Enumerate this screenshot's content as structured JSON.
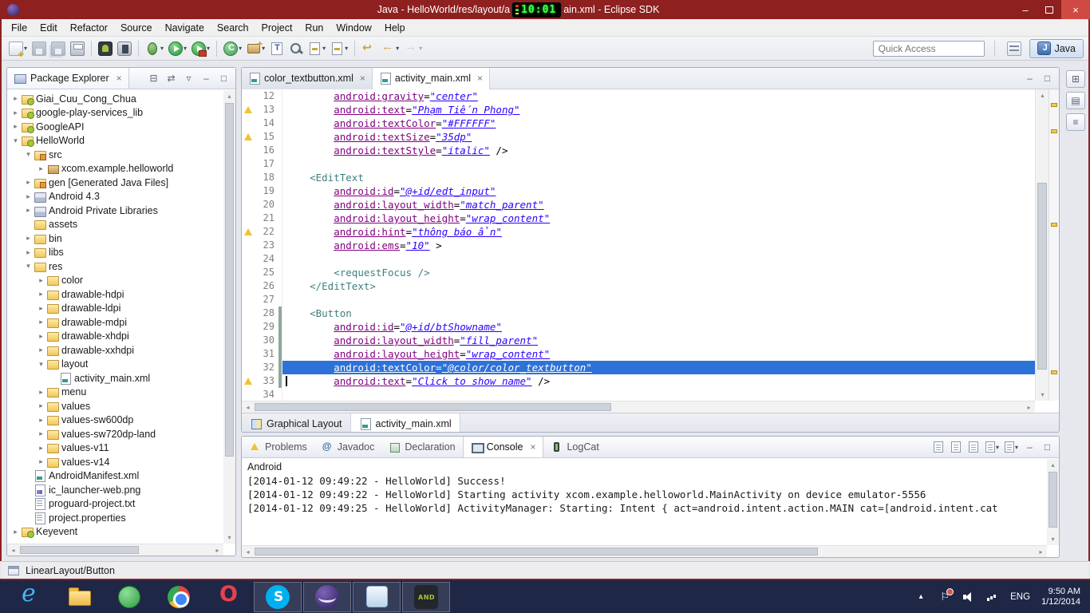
{
  "colors": {
    "titlebar": "#8e2020",
    "close_button": "#cf4a42",
    "selection": "#2d72d9",
    "taskbar": "#1f2747",
    "xml_attr": "#7f007f",
    "xml_value": "#2a00ff",
    "xml_tag": "#3f7f7f",
    "warning": "#f1c232",
    "clock_digits": "#42ff49"
  },
  "titlebar": {
    "title_left": "Java - HelloWorld/res/layout/a",
    "clock": "10:01",
    "title_right": "ain.xml - Eclipse SDK"
  },
  "menubar": [
    "File",
    "Edit",
    "Refactor",
    "Source",
    "Navigate",
    "Search",
    "Project",
    "Run",
    "Window",
    "Help"
  ],
  "toolbar": {
    "quick_access": "Quick Access",
    "perspective_label": "Java",
    "buttons": [
      {
        "name": "new-wizard",
        "kind": "new",
        "dropdown": true
      },
      {
        "name": "save",
        "kind": "save",
        "disabled": true
      },
      {
        "name": "save-all",
        "kind": "saveall",
        "disabled": true
      },
      {
        "name": "print",
        "kind": "print"
      },
      {
        "sep": true
      },
      {
        "name": "android-sdk-manager",
        "kind": "sdk"
      },
      {
        "name": "avd-manager",
        "kind": "avd"
      },
      {
        "sep": true
      },
      {
        "name": "debug",
        "kind": "debug",
        "dropdown": true
      },
      {
        "name": "run",
        "kind": "run",
        "dropdown": true
      },
      {
        "name": "run-external-tools",
        "kind": "ext",
        "dropdown": true
      },
      {
        "sep": true
      },
      {
        "name": "new-java-class",
        "kind": "newclass",
        "dropdown": true
      },
      {
        "name": "new-package",
        "kind": "newpkg",
        "dropdown": true
      },
      {
        "name": "open-type",
        "kind": "opentype"
      },
      {
        "name": "search",
        "kind": "search"
      },
      {
        "name": "next-annotation",
        "kind": "annot",
        "dropdown": true
      },
      {
        "name": "previous-annotation",
        "kind": "annot",
        "dropdown": true
      },
      {
        "sep": true
      },
      {
        "name": "last-edit-location",
        "kind": "lastedit"
      },
      {
        "name": "back",
        "kind": "back",
        "dropdown": true
      },
      {
        "name": "forward",
        "kind": "fwd",
        "dropdown": true,
        "disabled": true
      }
    ]
  },
  "package_explorer": {
    "tab_label": "Package Explorer",
    "toolbar": [
      {
        "name": "collapse-all",
        "glyph": "⊟"
      },
      {
        "name": "link-with-editor",
        "glyph": "⇄"
      },
      {
        "name": "view-menu",
        "glyph": "▿"
      },
      {
        "name": "minimize-view",
        "glyph": "–"
      },
      {
        "name": "maximize-view",
        "glyph": "□"
      }
    ],
    "tree": [
      {
        "label": "Giai_Cuu_Cong_Chua",
        "icon": "project",
        "depth": 0,
        "arrow": "closed"
      },
      {
        "label": "google-play-services_lib",
        "icon": "project",
        "depth": 0,
        "arrow": "closed"
      },
      {
        "label": "GoogleAPI",
        "icon": "project",
        "depth": 0,
        "arrow": "closed"
      },
      {
        "label": "HelloWorld",
        "icon": "project",
        "depth": 0,
        "arrow": "open"
      },
      {
        "label": "src",
        "icon": "src",
        "depth": 1,
        "arrow": "open"
      },
      {
        "label": "xcom.example.helloworld",
        "icon": "package",
        "depth": 2,
        "arrow": "closed"
      },
      {
        "label": "gen [Generated Java Files]",
        "icon": "src",
        "depth": 1,
        "arrow": "closed"
      },
      {
        "label": "Android 4.3",
        "icon": "library",
        "depth": 1,
        "arrow": "closed"
      },
      {
        "label": "Android Private Libraries",
        "icon": "library",
        "depth": 1,
        "arrow": "closed"
      },
      {
        "label": "assets",
        "icon": "folder",
        "depth": 1,
        "arrow": "none"
      },
      {
        "label": "bin",
        "icon": "folder",
        "depth": 1,
        "arrow": "closed"
      },
      {
        "label": "libs",
        "icon": "folder",
        "depth": 1,
        "arrow": "closed"
      },
      {
        "label": "res",
        "icon": "folder",
        "depth": 1,
        "arrow": "open"
      },
      {
        "label": "color",
        "icon": "folder",
        "depth": 2,
        "arrow": "closed"
      },
      {
        "label": "drawable-hdpi",
        "icon": "folder",
        "depth": 2,
        "arrow": "closed"
      },
      {
        "label": "drawable-ldpi",
        "icon": "folder",
        "depth": 2,
        "arrow": "closed"
      },
      {
        "label": "drawable-mdpi",
        "icon": "folder",
        "depth": 2,
        "arrow": "closed"
      },
      {
        "label": "drawable-xhdpi",
        "icon": "folder",
        "depth": 2,
        "arrow": "closed"
      },
      {
        "label": "drawable-xxhdpi",
        "icon": "folder",
        "depth": 2,
        "arrow": "closed"
      },
      {
        "label": "layout",
        "icon": "folder",
        "depth": 2,
        "arrow": "open"
      },
      {
        "label": "activity_main.xml",
        "icon": "xmlfile",
        "depth": 3,
        "arrow": "none"
      },
      {
        "label": "menu",
        "icon": "folder",
        "depth": 2,
        "arrow": "closed"
      },
      {
        "label": "values",
        "icon": "folder",
        "depth": 2,
        "arrow": "closed"
      },
      {
        "label": "values-sw600dp",
        "icon": "folder",
        "depth": 2,
        "arrow": "closed"
      },
      {
        "label": "values-sw720dp-land",
        "icon": "folder",
        "depth": 2,
        "arrow": "closed"
      },
      {
        "label": "values-v11",
        "icon": "folder",
        "depth": 2,
        "arrow": "closed"
      },
      {
        "label": "values-v14",
        "icon": "folder",
        "depth": 2,
        "arrow": "closed"
      },
      {
        "label": "AndroidManifest.xml",
        "icon": "xmlfile",
        "depth": 1,
        "arrow": "none"
      },
      {
        "label": "ic_launcher-web.png",
        "icon": "imagefile",
        "depth": 1,
        "arrow": "none"
      },
      {
        "label": "proguard-project.txt",
        "icon": "textfile",
        "depth": 1,
        "arrow": "none"
      },
      {
        "label": "project.properties",
        "icon": "textfile",
        "depth": 1,
        "arrow": "none"
      },
      {
        "label": "Keyevent",
        "icon": "project",
        "depth": 0,
        "arrow": "closed"
      }
    ]
  },
  "editor": {
    "tabs": [
      {
        "label": "color_textbutton.xml",
        "active": false
      },
      {
        "label": "activity_main.xml",
        "active": true
      }
    ],
    "toolbar": [
      {
        "name": "minimize-editor",
        "glyph": "–"
      },
      {
        "name": "maximize-editor",
        "glyph": "□"
      }
    ],
    "bottom_tabs": [
      {
        "label": "Graphical Layout",
        "icon": "layout",
        "active": false
      },
      {
        "label": "activity_main.xml",
        "icon": "xml",
        "active": true
      }
    ],
    "lines": [
      {
        "n": 12,
        "tok": [
          [
            "p",
            "        "
          ],
          [
            "a",
            "android:gravity"
          ],
          [
            "p",
            "="
          ],
          [
            "v",
            "\"center\""
          ]
        ]
      },
      {
        "n": 13,
        "warn": true,
        "tok": [
          [
            "p",
            "        "
          ],
          [
            "a",
            "android:text"
          ],
          [
            "p",
            "="
          ],
          [
            "v",
            "\"Phạm Tiến Phong\""
          ]
        ]
      },
      {
        "n": 14,
        "tok": [
          [
            "p",
            "        "
          ],
          [
            "a",
            "android:textColor"
          ],
          [
            "p",
            "="
          ],
          [
            "v",
            "\"#FFFFFF\""
          ]
        ]
      },
      {
        "n": 15,
        "warn": true,
        "tok": [
          [
            "p",
            "        "
          ],
          [
            "a",
            "android:textSize"
          ],
          [
            "p",
            "="
          ],
          [
            "v",
            "\"35dp\""
          ]
        ]
      },
      {
        "n": 16,
        "tok": [
          [
            "p",
            "        "
          ],
          [
            "a",
            "android:textStyle"
          ],
          [
            "p",
            "="
          ],
          [
            "v",
            "\"italic\""
          ],
          [
            "p",
            " />"
          ]
        ]
      },
      {
        "n": 17,
        "tok": []
      },
      {
        "n": 18,
        "tok": [
          [
            "p",
            "    "
          ],
          [
            "t",
            "<EditText"
          ]
        ]
      },
      {
        "n": 19,
        "tok": [
          [
            "p",
            "        "
          ],
          [
            "a",
            "android:id"
          ],
          [
            "p",
            "="
          ],
          [
            "v",
            "\"@+id/edt_input\""
          ]
        ]
      },
      {
        "n": 20,
        "tok": [
          [
            "p",
            "        "
          ],
          [
            "a",
            "android:layout_width"
          ],
          [
            "p",
            "="
          ],
          [
            "v",
            "\"match_parent\""
          ]
        ]
      },
      {
        "n": 21,
        "tok": [
          [
            "p",
            "        "
          ],
          [
            "a",
            "android:layout_height"
          ],
          [
            "p",
            "="
          ],
          [
            "v",
            "\"wrap_content\""
          ]
        ]
      },
      {
        "n": 22,
        "warn": true,
        "tok": [
          [
            "p",
            "        "
          ],
          [
            "a",
            "android:hint"
          ],
          [
            "p",
            "="
          ],
          [
            "v",
            "\"thông báo ẩn\""
          ]
        ]
      },
      {
        "n": 23,
        "tok": [
          [
            "p",
            "        "
          ],
          [
            "a",
            "android:ems"
          ],
          [
            "p",
            "="
          ],
          [
            "v",
            "\"10\""
          ],
          [
            "p",
            " >"
          ]
        ]
      },
      {
        "n": 24,
        "tok": []
      },
      {
        "n": 25,
        "tok": [
          [
            "p",
            "        "
          ],
          [
            "t",
            "<requestFocus />"
          ]
        ]
      },
      {
        "n": 26,
        "tok": [
          [
            "p",
            "    "
          ],
          [
            "t",
            "</EditText>"
          ]
        ]
      },
      {
        "n": 27,
        "tok": []
      },
      {
        "n": 28,
        "chg": true,
        "tok": [
          [
            "p",
            "    "
          ],
          [
            "t",
            "<Button"
          ]
        ]
      },
      {
        "n": 29,
        "chg": true,
        "tok": [
          [
            "p",
            "        "
          ],
          [
            "a",
            "android:id"
          ],
          [
            "p",
            "="
          ],
          [
            "v",
            "\"@+id/btShowname\""
          ]
        ]
      },
      {
        "n": 30,
        "chg": true,
        "tok": [
          [
            "p",
            "        "
          ],
          [
            "a",
            "android:layout_width"
          ],
          [
            "p",
            "="
          ],
          [
            "v",
            "\"fill_parent\""
          ]
        ]
      },
      {
        "n": 31,
        "chg": true,
        "tok": [
          [
            "p",
            "        "
          ],
          [
            "a",
            "android:layout_height"
          ],
          [
            "p",
            "="
          ],
          [
            "v",
            "\"wrap_content\""
          ]
        ]
      },
      {
        "n": 32,
        "chg": true,
        "sel": true,
        "tok": [
          [
            "p",
            "        "
          ],
          [
            "a",
            "android:textColor"
          ],
          [
            "p",
            "="
          ],
          [
            "v",
            "\"@color/color_textbutton\""
          ]
        ]
      },
      {
        "n": 33,
        "chg": true,
        "warn": true,
        "caret": true,
        "tok": [
          [
            "p",
            "        "
          ],
          [
            "a",
            "android:text"
          ],
          [
            "p",
            "="
          ],
          [
            "v",
            "\"Click to show name\""
          ],
          [
            "p",
            " />"
          ]
        ]
      },
      {
        "n": 34,
        "tok": []
      }
    ]
  },
  "console": {
    "tabs": [
      {
        "label": "Problems",
        "icon": "problems",
        "active": false
      },
      {
        "label": "Javadoc",
        "icon": "javadoc",
        "active": false
      },
      {
        "label": "Declaration",
        "icon": "declaration",
        "active": false
      },
      {
        "label": "Console",
        "icon": "console",
        "active": true
      },
      {
        "label": "LogCat",
        "icon": "logcat",
        "active": false
      }
    ],
    "toolbar": [
      {
        "name": "clear-console"
      },
      {
        "name": "scroll-lock"
      },
      {
        "name": "pin-console"
      },
      {
        "name": "display-selected-console",
        "dd": true
      },
      {
        "name": "open-console",
        "dd": true
      },
      {
        "name": "minimize-view",
        "glyph": "–"
      },
      {
        "name": "maximize-view",
        "glyph": "□"
      }
    ],
    "title": "Android",
    "lines": [
      "[2014-01-12 09:49:22 - HelloWorld] Success!",
      "[2014-01-12 09:49:22 - HelloWorld] Starting activity xcom.example.helloworld.MainActivity on device emulator-5556",
      "[2014-01-12 09:49:25 - HelloWorld] ActivityManager: Starting: Intent { act=android.intent.action.MAIN cat=[android.intent.cat"
    ]
  },
  "minibar": [
    {
      "name": "restore-views",
      "glyph": "⊞"
    },
    {
      "name": "outline-view",
      "glyph": "▤"
    },
    {
      "name": "task-list-view",
      "glyph": "≡"
    }
  ],
  "statusbar": {
    "selection": "LinearLayout/Button"
  },
  "taskbar": {
    "icons": [
      {
        "name": "internet-explorer",
        "running": false
      },
      {
        "name": "file-explorer",
        "running": false
      },
      {
        "name": "app-green",
        "running": false
      },
      {
        "name": "chrome",
        "running": false
      },
      {
        "name": "opera",
        "running": false
      },
      {
        "name": "skype",
        "running": true
      },
      {
        "name": "eclipse",
        "running": true
      },
      {
        "name": "app-light",
        "running": true
      },
      {
        "name": "android-sdk",
        "running": true
      }
    ],
    "tray": {
      "lang": "ENG",
      "time": "9:50 AM",
      "date": "1/12/2014"
    }
  }
}
